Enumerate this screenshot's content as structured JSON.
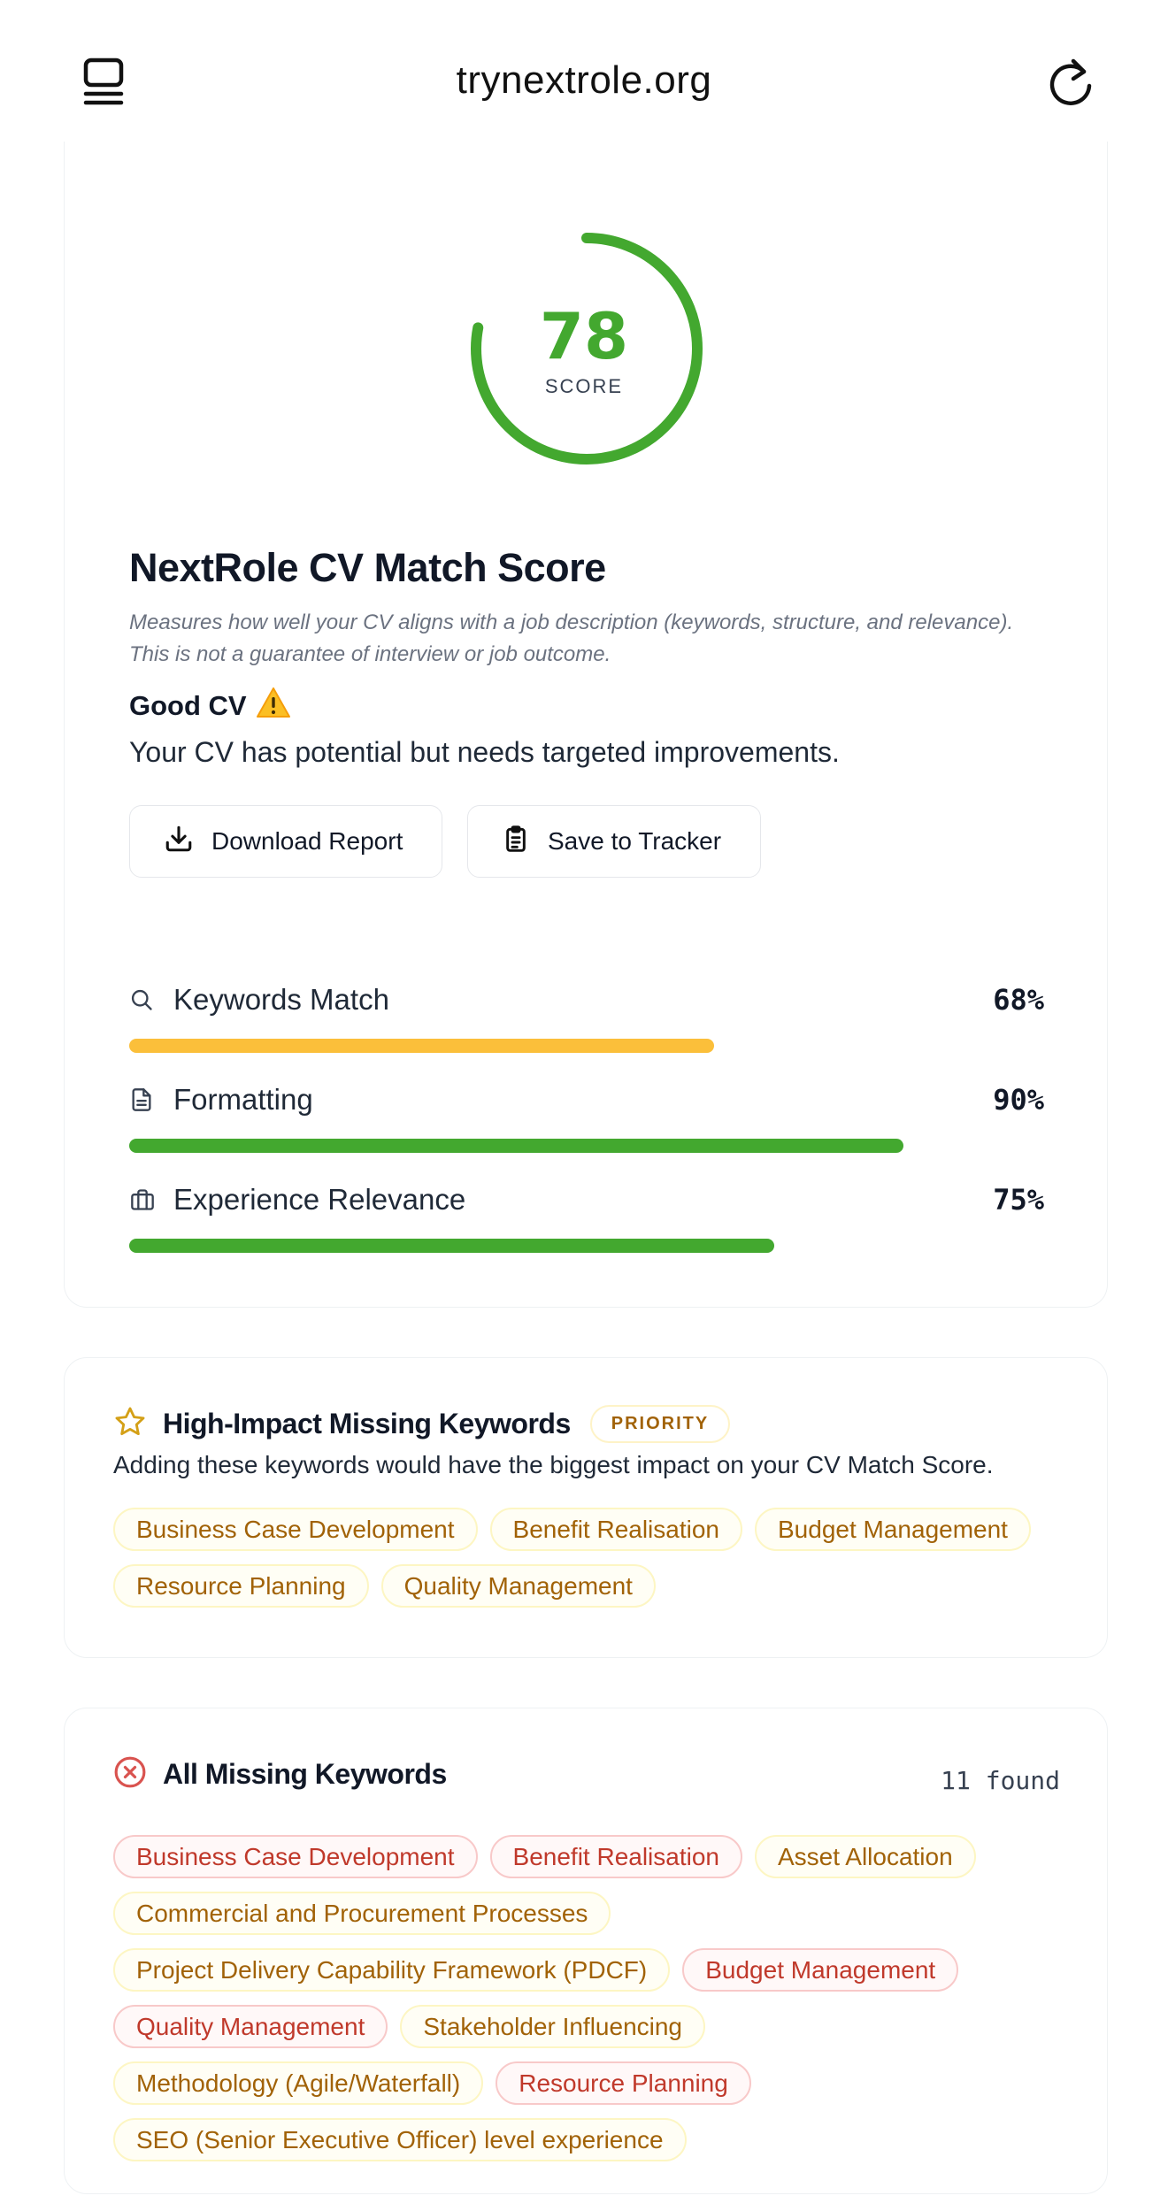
{
  "header": {
    "title": "trynextrole.org",
    "left_icon": "sidebar-toggle-icon",
    "right_icon": "refresh-icon"
  },
  "score": {
    "value": "78",
    "fraction": 0.78,
    "label": "SCORE",
    "color": "#43a82f"
  },
  "summary": {
    "title": "NextRole CV Match Score",
    "description": "Measures how well your CV aligns with a job description (keywords, structure, and relevance). This is not a guarantee of interview or job outcome.",
    "verdict": "Good CV",
    "verdict_icon": "warning-icon",
    "message": "Your CV has potential but needs targeted improvements."
  },
  "actions": {
    "download_label": "Download Report",
    "save_label": "Save to Tracker"
  },
  "metrics": [
    {
      "label": "Keywords Match",
      "percent": "68%",
      "value": 68,
      "color": "#fbbf3a",
      "icon": "search-icon"
    },
    {
      "label": "Formatting",
      "percent": "90%",
      "value": 90,
      "color": "#43a82f",
      "icon": "document-icon"
    },
    {
      "label": "Experience Relevance",
      "percent": "75%",
      "value": 75,
      "color": "#43a82f",
      "icon": "briefcase-icon"
    }
  ],
  "high_impact": {
    "title": "High-Impact Missing Keywords",
    "badge": "PRIORITY",
    "description": "Adding these keywords would have the biggest impact on your CV Match Score.",
    "keywords": [
      "Business Case Development",
      "Benefit Realisation",
      "Budget Management",
      "Resource Planning",
      "Quality Management"
    ]
  },
  "all_missing": {
    "title": "All Missing Keywords",
    "count_text": "11 found",
    "keywords": [
      {
        "text": "Business Case Development",
        "tone": "red"
      },
      {
        "text": "Benefit Realisation",
        "tone": "red"
      },
      {
        "text": "Asset Allocation",
        "tone": "amber"
      },
      {
        "text": "Commercial and Procurement Processes",
        "tone": "amber"
      },
      {
        "text": "Project Delivery Capability Framework (PDCF)",
        "tone": "amber"
      },
      {
        "text": "Budget Management",
        "tone": "red"
      },
      {
        "text": "Quality Management",
        "tone": "red"
      },
      {
        "text": "Stakeholder Influencing",
        "tone": "amber"
      },
      {
        "text": "Methodology (Agile/Waterfall)",
        "tone": "amber"
      },
      {
        "text": "Resource Planning",
        "tone": "red"
      },
      {
        "text": "SEO (Senior Executive Officer) level experience",
        "tone": "amber"
      }
    ]
  }
}
